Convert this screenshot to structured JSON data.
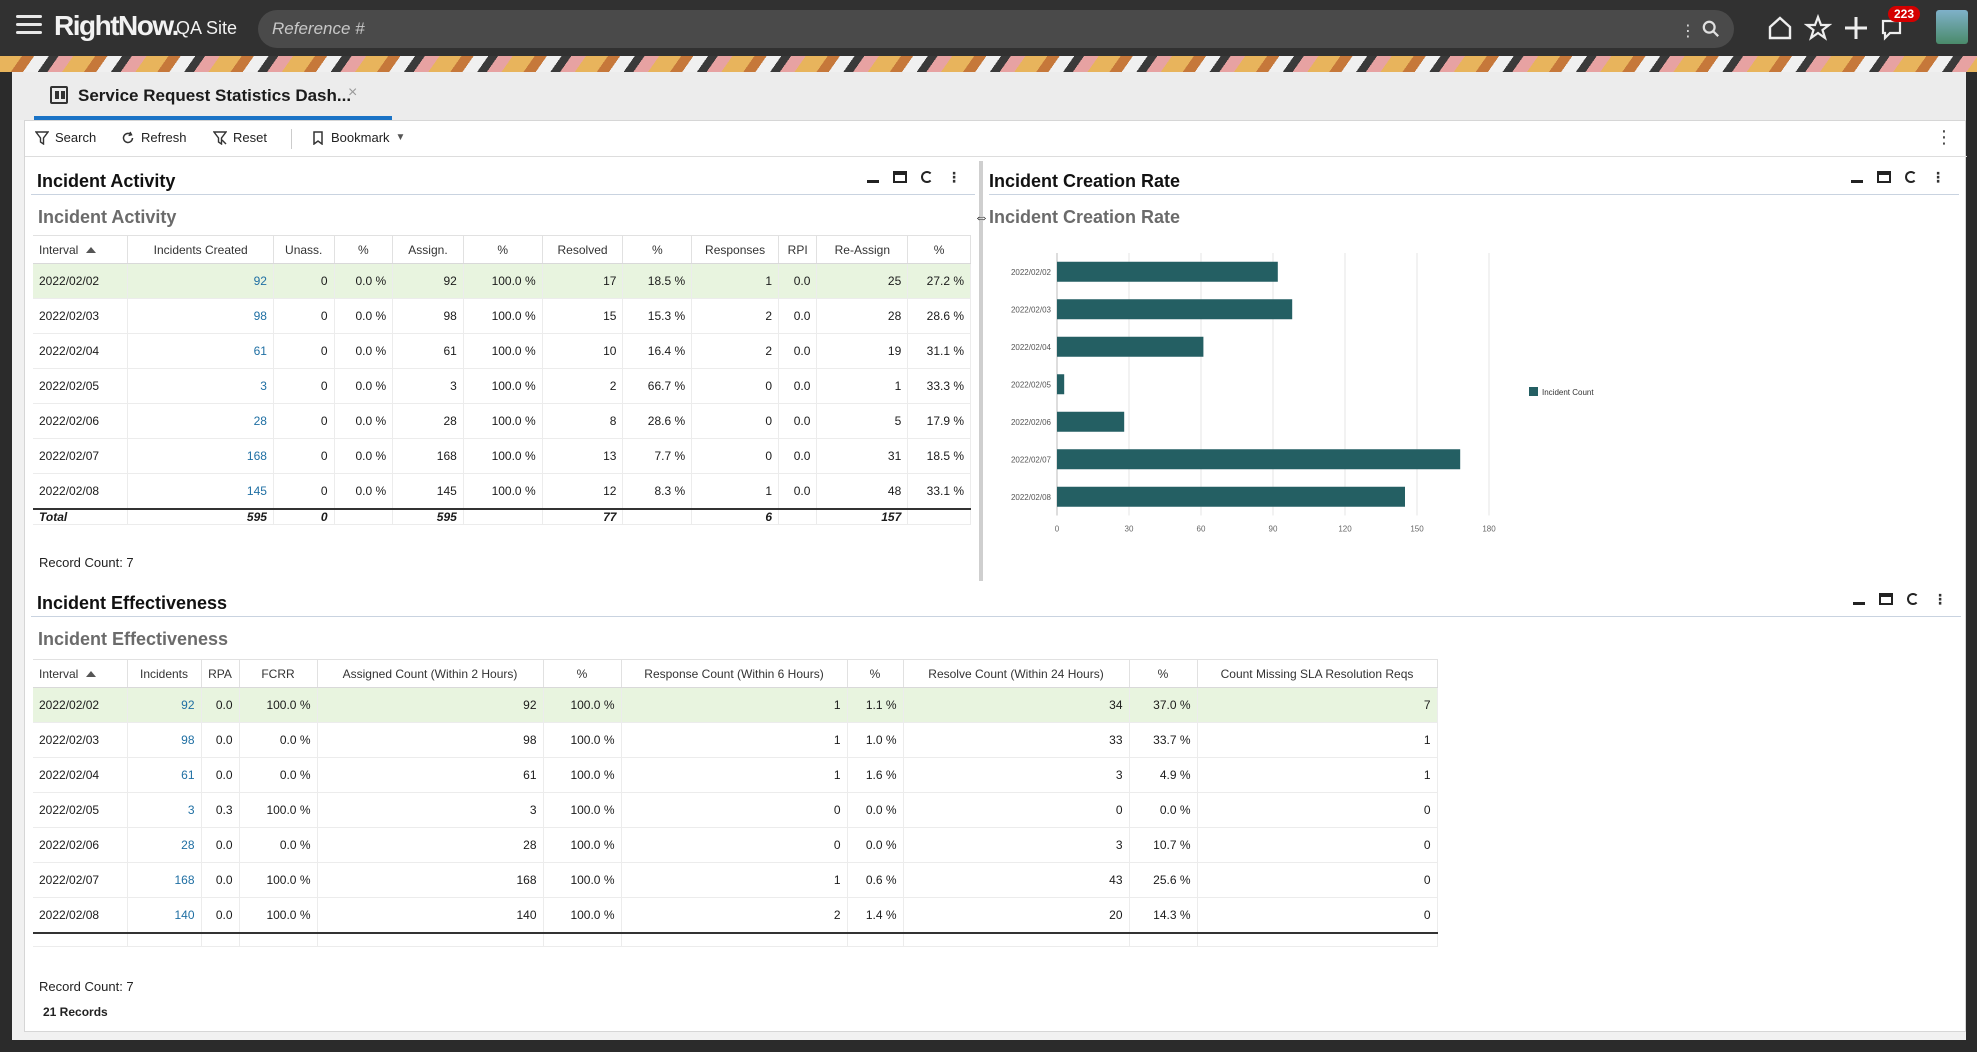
{
  "topbar": {
    "brand": "RightNow.",
    "site": "QA Site",
    "search_placeholder": "Reference #",
    "notifications": "223"
  },
  "tab": {
    "label": "Service Request Statistics Dash...",
    "close": "×"
  },
  "toolbar": {
    "search": "Search",
    "refresh": "Refresh",
    "reset": "Reset",
    "bookmark": "Bookmark",
    "kebab": "⋮"
  },
  "activity": {
    "title": "Incident Activity",
    "subtitle": "Incident Activity",
    "columns": [
      "Interval",
      "Incidents Created",
      "Unass.",
      "%",
      "Assign.",
      "%",
      "Resolved",
      "%",
      "Responses",
      "RPI",
      "Re-Assign",
      "%"
    ],
    "rows": [
      [
        "2022/02/02",
        "92",
        "0",
        "0.0 %",
        "92",
        "100.0 %",
        "17",
        "18.5 %",
        "1",
        "0.0",
        "25",
        "27.2 %"
      ],
      [
        "2022/02/03",
        "98",
        "0",
        "0.0 %",
        "98",
        "100.0 %",
        "15",
        "15.3 %",
        "2",
        "0.0",
        "28",
        "28.6 %"
      ],
      [
        "2022/02/04",
        "61",
        "0",
        "0.0 %",
        "61",
        "100.0 %",
        "10",
        "16.4 %",
        "2",
        "0.0",
        "19",
        "31.1 %"
      ],
      [
        "2022/02/05",
        "3",
        "0",
        "0.0 %",
        "3",
        "100.0 %",
        "2",
        "66.7 %",
        "0",
        "0.0",
        "1",
        "33.3 %"
      ],
      [
        "2022/02/06",
        "28",
        "0",
        "0.0 %",
        "28",
        "100.0 %",
        "8",
        "28.6 %",
        "0",
        "0.0",
        "5",
        "17.9 %"
      ],
      [
        "2022/02/07",
        "168",
        "0",
        "0.0 %",
        "168",
        "100.0 %",
        "13",
        "7.7 %",
        "0",
        "0.0",
        "31",
        "18.5 %"
      ],
      [
        "2022/02/08",
        "145",
        "0",
        "0.0 %",
        "145",
        "100.0 %",
        "12",
        "8.3 %",
        "1",
        "0.0",
        "48",
        "33.1 %"
      ]
    ],
    "total": [
      "Total",
      "595",
      "0",
      "",
      "595",
      "",
      "77",
      "",
      "6",
      "",
      "157",
      ""
    ],
    "record_count": "Record Count: 7"
  },
  "creation": {
    "title": "Incident Creation Rate",
    "subtitle": "Incident Creation Rate"
  },
  "chart_data": {
    "type": "bar",
    "orientation": "horizontal",
    "categories": [
      "2022/02/02",
      "2022/02/03",
      "2022/02/04",
      "2022/02/05",
      "2022/02/06",
      "2022/02/07",
      "2022/02/08"
    ],
    "series": [
      {
        "name": "Incident Count",
        "values": [
          92,
          98,
          61,
          3,
          28,
          168,
          145
        ],
        "color": "#245f63"
      }
    ],
    "xticks": [
      "0",
      "30",
      "60",
      "90",
      "120",
      "150",
      "180"
    ],
    "xlim": [
      0,
      180
    ],
    "grid": true,
    "legend": "right"
  },
  "effectiveness": {
    "title": "Incident Effectiveness",
    "subtitle": "Incident Effectiveness",
    "columns": [
      "Interval",
      "Incidents",
      "RPA",
      "FCRR",
      "Assigned Count (Within 2 Hours)",
      "%",
      "Response Count (Within 6 Hours)",
      "%",
      "Resolve Count (Within 24 Hours)",
      "%",
      "Count Missing SLA Resolution Reqs"
    ],
    "rows": [
      [
        "2022/02/02",
        "92",
        "0.0",
        "100.0 %",
        "92",
        "100.0 %",
        "1",
        "1.1 %",
        "34",
        "37.0 %",
        "7"
      ],
      [
        "2022/02/03",
        "98",
        "0.0",
        "0.0 %",
        "98",
        "100.0 %",
        "1",
        "1.0 %",
        "33",
        "33.7 %",
        "1"
      ],
      [
        "2022/02/04",
        "61",
        "0.0",
        "0.0 %",
        "61",
        "100.0 %",
        "1",
        "1.6 %",
        "3",
        "4.9 %",
        "1"
      ],
      [
        "2022/02/05",
        "3",
        "0.3",
        "100.0 %",
        "3",
        "100.0 %",
        "0",
        "0.0 %",
        "0",
        "0.0 %",
        "0"
      ],
      [
        "2022/02/06",
        "28",
        "0.0",
        "0.0 %",
        "28",
        "100.0 %",
        "0",
        "0.0 %",
        "3",
        "10.7 %",
        "0"
      ],
      [
        "2022/02/07",
        "168",
        "0.0",
        "100.0 %",
        "168",
        "100.0 %",
        "1",
        "0.6 %",
        "43",
        "25.6 %",
        "0"
      ],
      [
        "2022/02/08",
        "140",
        "0.0",
        "100.0 %",
        "140",
        "100.0 %",
        "2",
        "1.4 %",
        "20",
        "14.3 %",
        "0"
      ]
    ],
    "record_count": "Record Count: 7"
  },
  "footer": {
    "records": "21 Records"
  }
}
